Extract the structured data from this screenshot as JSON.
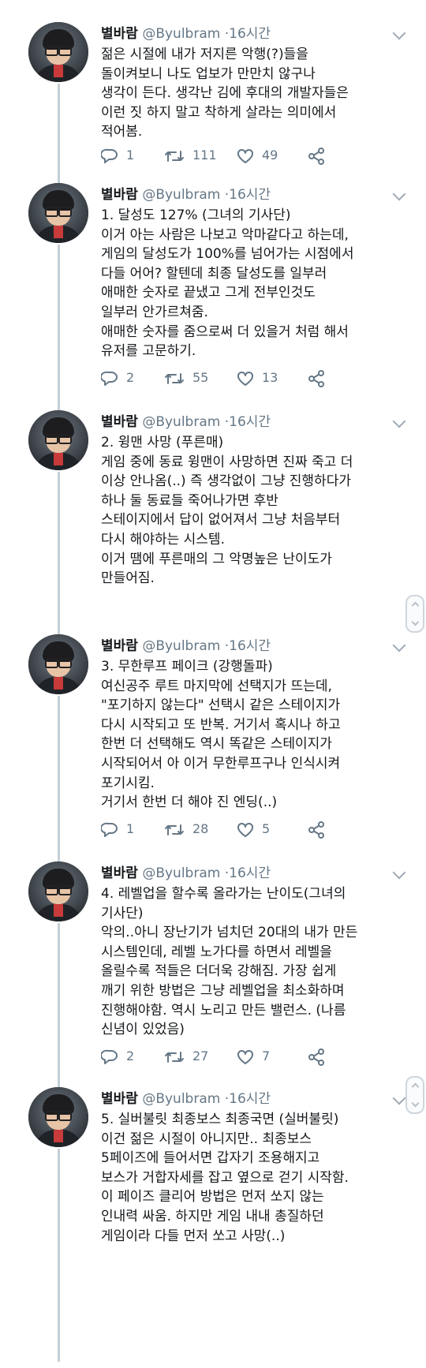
{
  "tweets": [
    {
      "name": "별바람",
      "handle": "@Byulbram",
      "separator": "·",
      "time": "16시간",
      "lines": [
        "젊은 시절에 내가 저지른 악행(?)들을",
        "돌이켜보니 나도 업보가 만만치 않구나",
        "생각이 든다. 생각난 김에 후대의 개발자들은",
        "이런 짓 하지 말고 착하게 살라는 의미에서",
        "적어봄."
      ],
      "replies": "1",
      "retweets": "111",
      "likes": "49"
    },
    {
      "name": "별바람",
      "handle": "@Byulbram",
      "separator": "·",
      "time": "16시간",
      "lines": [
        "1. 달성도 127% (그녀의 기사단)",
        "이거 아는 사람은 나보고 악마같다고 하는데,",
        "게임의 달성도가 100%를 넘어가는 시점에서",
        "다들 어어? 할텐데 최종 달성도를 일부러",
        "애매한 숫자로 끝냈고 그게 전부인것도",
        "일부러 안가르쳐줌.",
        "애매한 숫자를 줌으로써 더 있을거 처럼 해서",
        "유저를 고문하기."
      ],
      "replies": "2",
      "retweets": "55",
      "likes": "13"
    },
    {
      "name": "별바람",
      "handle": "@Byulbram",
      "separator": "·",
      "time": "16시간",
      "lines": [
        "2. 윙맨 사망 (푸른매)",
        "게임 중에 동료 윙맨이 사망하면 진짜 죽고 더",
        "이상 안나옴(..) 즉 생각없이 그냥 진행하다가",
        "하나 둘 동료들 죽어나가면 후반",
        "스테이지에서 답이 없어져서 그냥 처음부터",
        "다시 해야하는 시스템.",
        "이거 땜에 푸른매의 그 악명높은 난이도가",
        "만들어짐."
      ],
      "replies": "",
      "retweets": "",
      "likes": ""
    },
    {
      "name": "별바람",
      "handle": "@Byulbram",
      "separator": "·",
      "time": "16시간",
      "lines": [
        "3. 무한루프 페이크 (강행돌파)",
        "여신공주 루트 마지막에 선택지가 뜨는데,",
        "\"포기하지 않는다\" 선택시 같은 스테이지가",
        "다시 시작되고 또 반복. 거기서 혹시나 하고",
        "한번 더 선택해도 역시 똑같은 스테이지가",
        "시작되어서 아 이거 무한루프구나 인식시켜",
        "포기시킴.",
        "거기서 한번 더 해야 진 엔딩(..)"
      ],
      "replies": "1",
      "retweets": "28",
      "likes": "5"
    },
    {
      "name": "별바람",
      "handle": "@Byulbram",
      "separator": "·",
      "time": "16시간",
      "lines": [
        "4. 레벨업을 할수록 올라가는 난이도(그녀의",
        "기사단)",
        "악의..아니 장난기가 넘치던 20대의 내가 만든",
        "시스템인데, 레벨 노가다를 하면서 레벨을",
        "올릴수록 적들은 더더욱 강해짐. 가장 쉽게",
        "깨기 위한 방법은 그냥 레벨업을 최소화하며",
        "진행해야함. 역시 노리고 만든 밸런스. (나름",
        "신념이 있었음)"
      ],
      "replies": "2",
      "retweets": "27",
      "likes": "7"
    },
    {
      "name": "별바람",
      "handle": "@Byulbram",
      "separator": "·",
      "time": "16시간",
      "lines": [
        "5. 실버불릿 최종보스 최종국면 (실버불릿)",
        "이건 젊은 시절이 아니지만.. 최종보스",
        "5페이즈에 들어서면 갑자기 조용해지고",
        "보스가 거합자세를 잡고 옆으로 걷기 시작함.",
        "이 페이즈 클리어 방법은 먼저 쏘지 않는",
        "인내력 싸움. 하지만 게임 내내 총질하던",
        "게임이라 다들 먼저 쏘고 사망(..)"
      ],
      "replies": "",
      "retweets": "",
      "likes": ""
    }
  ],
  "icons": {
    "reply": "reply-icon",
    "retweet": "retweet-icon",
    "like": "heart-icon",
    "share": "share-icon",
    "more": "chevron-down-icon"
  },
  "colors": {
    "text": "#14171a",
    "meta": "#657786",
    "thread": "#c4cfd6"
  }
}
